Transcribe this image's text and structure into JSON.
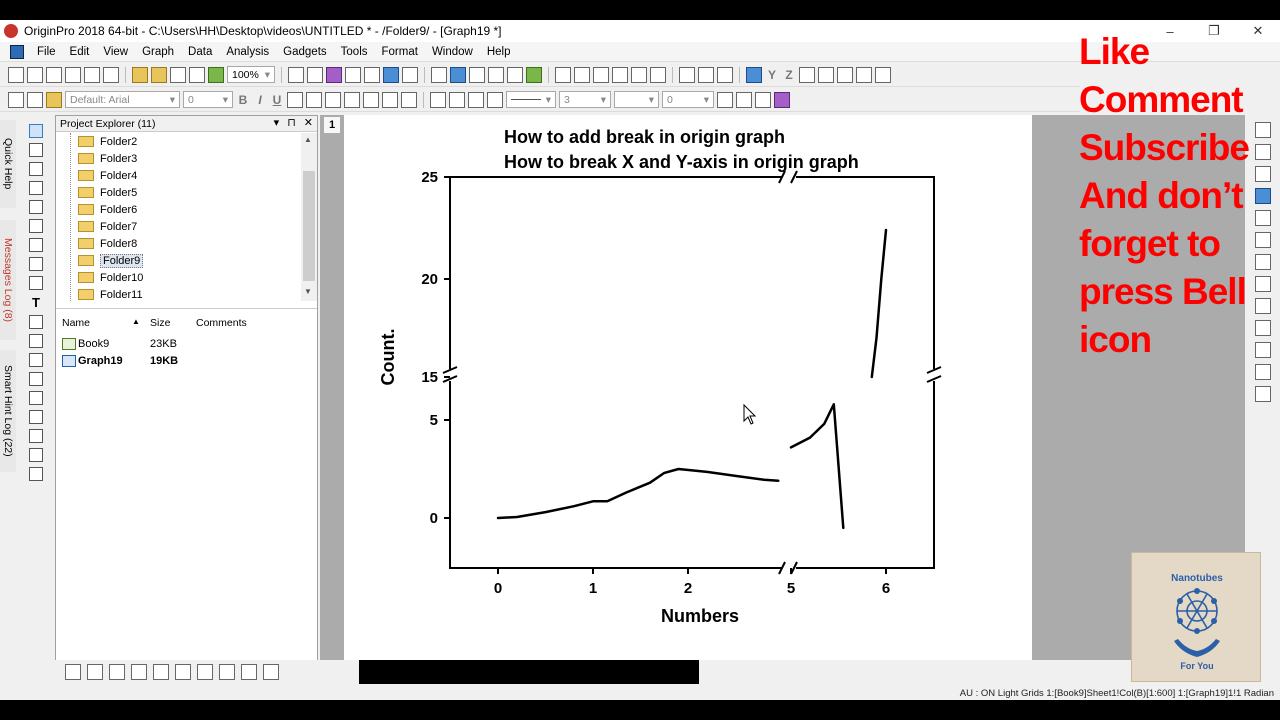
{
  "window": {
    "title": "OriginPro 2018 64-bit - C:\\Users\\HH\\Desktop\\videos\\UNTITLED * - /Folder9/ - [Graph19 *]",
    "min": "–",
    "max": "❐",
    "close": "✕"
  },
  "menu": [
    "File",
    "Edit",
    "View",
    "Graph",
    "Data",
    "Analysis",
    "Gadgets",
    "Tools",
    "Format",
    "Window",
    "Help"
  ],
  "toolbar": {
    "zoom": "100%",
    "font": "Default: Arial",
    "font_size": "0",
    "line_width": "3",
    "angle": "0"
  },
  "side_tabs": {
    "quick_help": "Quick Help",
    "messages_log": "Messages Log (8)",
    "smart_hint_log": "Smart Hint Log (22)"
  },
  "project_explorer": {
    "title": "Project Explorer (11)",
    "folders": [
      "Folder2",
      "Folder3",
      "Folder4",
      "Folder5",
      "Folder6",
      "Folder7",
      "Folder8",
      "Folder9",
      "Folder10",
      "Folder11"
    ],
    "selected_folder": "Folder9",
    "columns": {
      "name": "Name",
      "size": "Size",
      "comments": "Comments"
    },
    "files": [
      {
        "name": "Book9",
        "size": "23KB",
        "type": "workbook"
      },
      {
        "name": "Graph19",
        "size": "19KB",
        "type": "graph"
      }
    ]
  },
  "workspace": {
    "layer_tab": "1"
  },
  "graph": {
    "title_line1": "How to add break in origin graph",
    "title_line2": "How to break X and Y-axis in origin graph",
    "xlabel": "Numbers",
    "ylabel": "Count."
  },
  "chart_data": {
    "type": "line",
    "xlabel": "Numbers",
    "ylabel": "Count.",
    "x_ticks": [
      "0",
      "1",
      "2",
      "5",
      "6"
    ],
    "y_ticks": [
      "0",
      "5",
      "15",
      "20",
      "25"
    ],
    "x_break": [
      3,
      4.8
    ],
    "y_break": [
      6,
      14
    ],
    "series": [
      {
        "x": [
          0,
          0.2,
          0.5,
          0.8,
          1.0,
          1.15,
          1.35,
          1.6,
          1.75,
          1.9,
          2.2,
          2.5,
          2.8,
          2.95
        ],
        "y": [
          0,
          0.05,
          0.3,
          0.6,
          0.85,
          0.85,
          1.3,
          1.8,
          2.3,
          2.5,
          2.35,
          2.15,
          1.95,
          1.9
        ]
      },
      {
        "x": [
          5.0,
          5.2,
          5.35,
          5.45,
          5.55
        ],
        "y": [
          3.6,
          4.1,
          4.8,
          5.8,
          7.3
        ]
      },
      {
        "x": [
          5.85,
          5.9,
          5.95,
          6.0
        ],
        "y": [
          15.0,
          17.0,
          20.0,
          22.5
        ]
      }
    ]
  },
  "statusbar": "AU : ON  Light Grids  1:[Book9]Sheet1!Col(B)[1:600]  1:[Graph19]1!1  Radian",
  "overlay": {
    "lines": [
      "Like",
      "Comment",
      "Subscribe",
      "And don’t",
      "forget to",
      "press Bell",
      "icon"
    ]
  },
  "badge": {
    "text_top": "Nanotubes",
    "text_bottom": "For You"
  }
}
